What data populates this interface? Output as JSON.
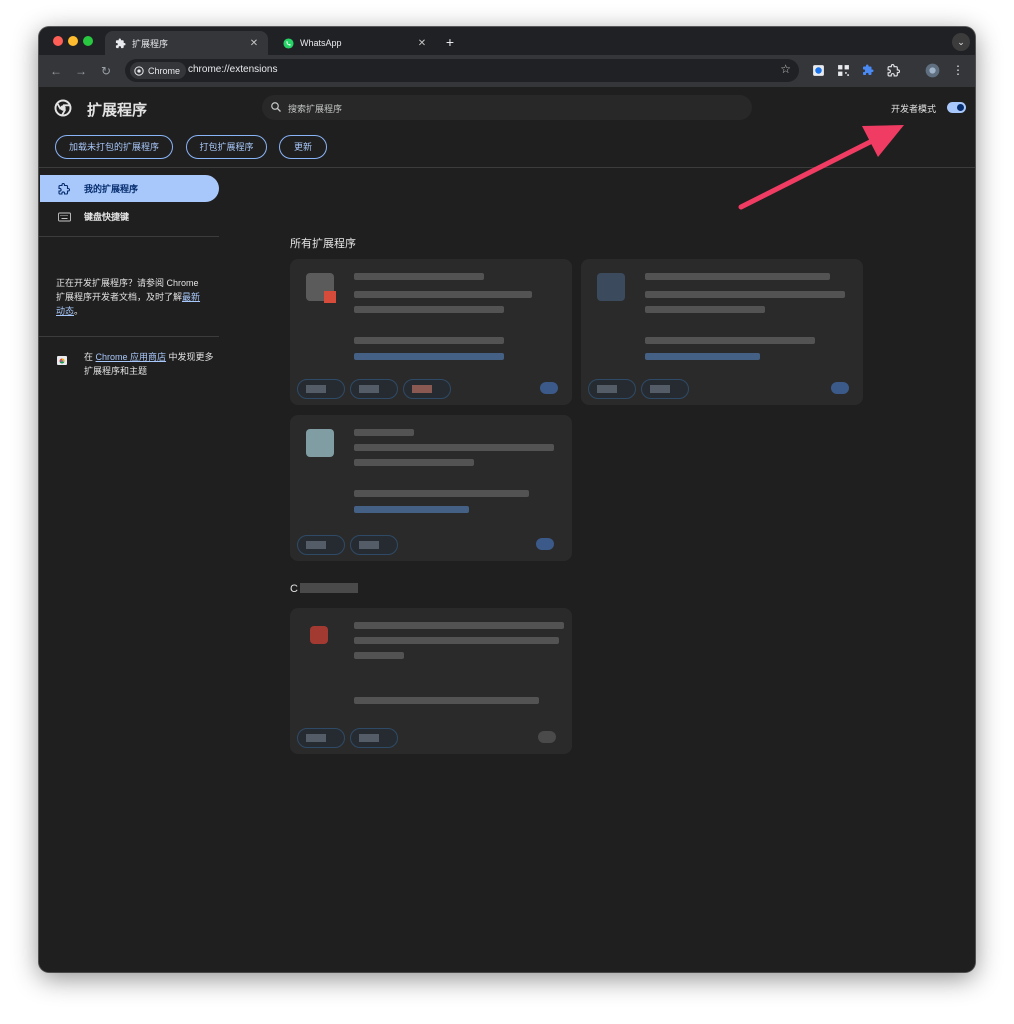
{
  "browser": {
    "tabs": [
      {
        "title": "扩展程序",
        "icon": "puzzle-icon",
        "active": true
      },
      {
        "title": "WhatsApp",
        "icon": "whatsapp-icon",
        "active": false
      }
    ],
    "address": {
      "chip": "Chrome",
      "url": "chrome://extensions"
    }
  },
  "header": {
    "title": "扩展程序",
    "search_placeholder": "搜索扩展程序",
    "dev_mode_label": "开发者模式",
    "dev_mode_on": true
  },
  "actions": {
    "load_unpacked": "加载未打包的扩展程序",
    "pack": "打包扩展程序",
    "update": "更新"
  },
  "sidebar": {
    "items": [
      {
        "label": "我的扩展程序",
        "icon": "extension-icon",
        "selected": true
      },
      {
        "label": "键盘快捷键",
        "icon": "keyboard-icon",
        "selected": false
      }
    ],
    "info_text": "正在开发扩展程序？请参阅 Chrome 扩展程序开发者文档，及时了解",
    "info_link": "最新动态",
    "info_end": "。",
    "store_prefix": "在 ",
    "store_link": "Chrome 应用商店",
    "store_suffix": " 中发现更多扩展程序和主题"
  },
  "content": {
    "all_title": "所有扩展程序",
    "chrome_title": "C"
  },
  "colors": {
    "accent": "#a8c7fa",
    "background": "#1f1f1f",
    "card": "#2a2a2a",
    "annotation_arrow": "#f03c63"
  }
}
